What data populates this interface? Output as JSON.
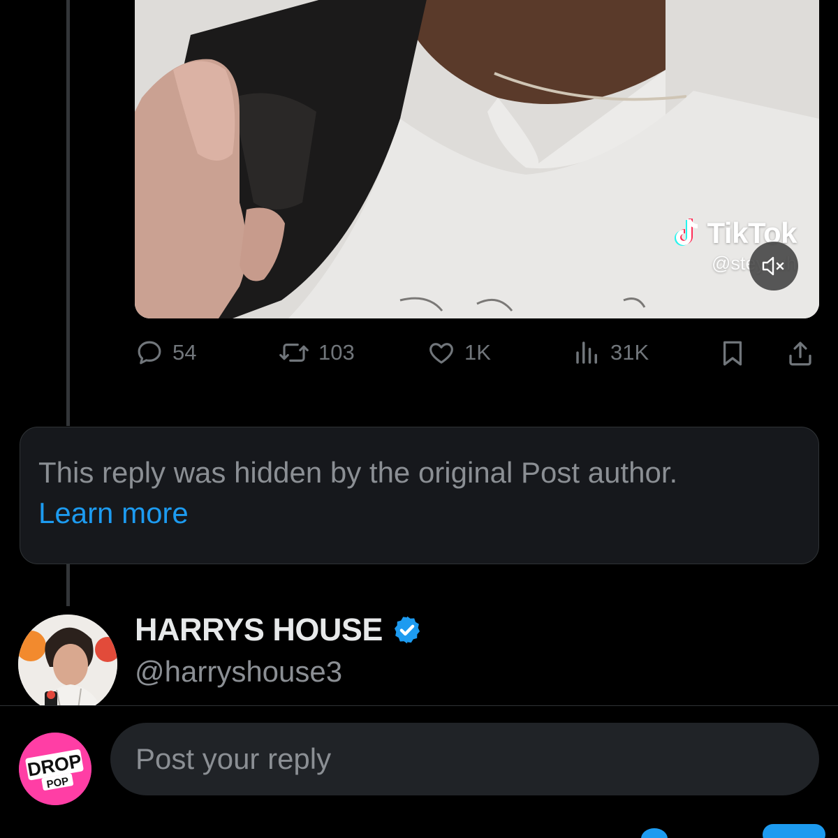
{
  "media": {
    "watermark_brand": "TikTok",
    "watermark_handle": "@steyeuh",
    "mute_icon": "speaker-muted-icon"
  },
  "actions": {
    "replies": "54",
    "reposts": "103",
    "likes": "1K",
    "views": "31K",
    "icons": [
      "reply-icon",
      "repost-icon",
      "like-icon",
      "views-icon",
      "bookmark-icon",
      "share-icon"
    ]
  },
  "hidden_reply": {
    "message": "This reply was hidden by the original Post author.",
    "link": "Learn more"
  },
  "next_post": {
    "display_name": "HARRYS HOUSE",
    "handle": "@harryshouse3",
    "verified": true
  },
  "composer": {
    "placeholder": "Post your reply",
    "avatar_label_top": "DROP",
    "avatar_label_bottom": "POP"
  },
  "colors": {
    "background": "#000000",
    "accent": "#1d9bf0",
    "muted_text": "#8b8f94",
    "card_bg": "#16181c",
    "input_bg": "#202327",
    "avatar_pink": "#ff3ea5"
  }
}
